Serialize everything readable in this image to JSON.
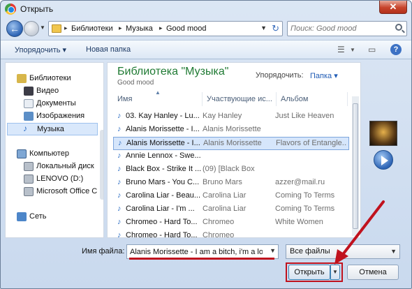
{
  "window": {
    "title": "Открыть",
    "close_label": "✕"
  },
  "nav": {
    "breadcrumbs": [
      "Библиотеки",
      "Музыка",
      "Good mood"
    ],
    "search_placeholder": "Поиск: Good mood"
  },
  "toolbar": {
    "organize": "Упорядочить ▾",
    "new_folder": "Новая папка"
  },
  "sidebar": {
    "items": [
      {
        "label": "Библиотеки",
        "icon": "libraries-icon"
      },
      {
        "label": "Видео",
        "icon": "video-icon"
      },
      {
        "label": "Документы",
        "icon": "documents-icon"
      },
      {
        "label": "Изображения",
        "icon": "images-icon"
      },
      {
        "label": "Музыка",
        "icon": "music-icon"
      },
      {
        "label": "Компьютер",
        "icon": "computer-icon"
      },
      {
        "label": "Локальный диск",
        "icon": "drive-icon"
      },
      {
        "label": "LENOVO (D:)",
        "icon": "drive-icon"
      },
      {
        "label": "Microsoft Office C",
        "icon": "drive-icon"
      },
      {
        "label": "Сеть",
        "icon": "network-icon"
      }
    ]
  },
  "library": {
    "title": "Библиотека \"Музыка\"",
    "subtitle": "Good mood",
    "arrange_label": "Упорядочить:",
    "arrange_value": "Папка ▾"
  },
  "table": {
    "columns": [
      "Имя",
      "Участвующие ис...",
      "Альбом"
    ],
    "rows": [
      {
        "name": "03. Kay Hanley - Lu...",
        "artist": "Kay Hanley",
        "album": "Just Like Heaven"
      },
      {
        "name": "Alanis Morissette - I...",
        "artist": "Alanis Morissette",
        "album": ""
      },
      {
        "name": "Alanis Morissette - I...",
        "artist": "Alanis Morissette",
        "album": "Flavors of Entangle..."
      },
      {
        "name": "Annie Lennox - Swe...",
        "artist": "",
        "album": ""
      },
      {
        "name": "Black Box - Strike It ...",
        "artist": "(09) [Black Box",
        "album": ""
      },
      {
        "name": "Bruno Mars - You C...",
        "artist": "Bruno Mars",
        "album": "azzer@mail.ru"
      },
      {
        "name": "Carolina Liar - Beau...",
        "artist": "Carolina Liar",
        "album": "Coming To Terms"
      },
      {
        "name": "Carolina Liar - I'm ...",
        "artist": "Carolina Liar",
        "album": "Coming To Terms"
      },
      {
        "name": "Chromeo - Hard To...",
        "artist": "Chromeo",
        "album": "White Women"
      },
      {
        "name": "Chromeo - Hard To...",
        "artist": "Chromeo",
        "album": ""
      }
    ]
  },
  "footer": {
    "filename_label": "Имя файла:",
    "filename_value": "Alanis Morissette - I am a bitch, i'm a lover",
    "filetype": "Все файлы",
    "open_label": "Открыть",
    "cancel_label": "Отмена"
  },
  "colors": {
    "accent_red": "#c0121e",
    "library_green": "#1f7a33",
    "link_blue": "#1f5bb5"
  }
}
